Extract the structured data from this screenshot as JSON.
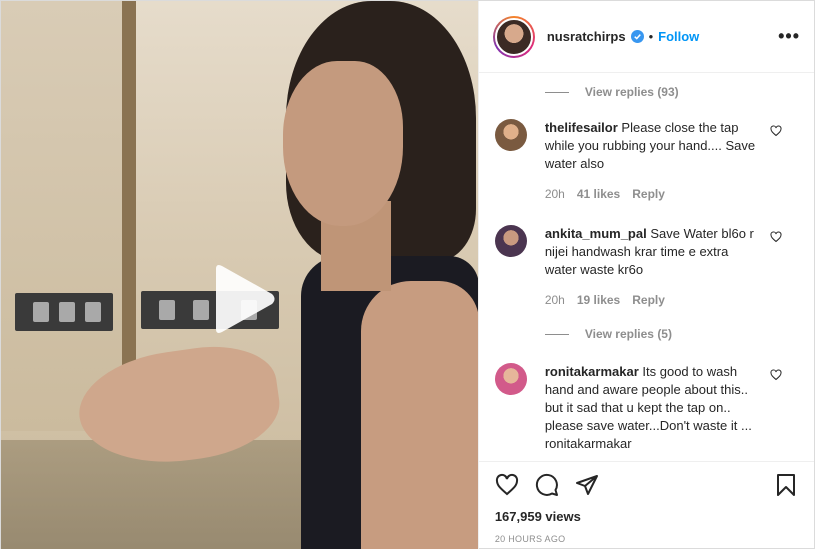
{
  "header": {
    "username": "nusratchirps",
    "separator": "•",
    "follow_label": "Follow",
    "more_label": "•••"
  },
  "comments": {
    "view_replies_top": "View replies (93)",
    "items": [
      {
        "user": "thelifesailor",
        "text": "Please close the tap while you rubbing your hand.... Save water also",
        "age": "20h",
        "likes": "41 likes",
        "reply_label": "Reply",
        "avatar_color": "#a07a5a"
      },
      {
        "user": "ankita_mum_pal",
        "text": "Save Water bl6o r nijei handwash krar time e extra water waste kr6o",
        "age": "20h",
        "likes": "19 likes",
        "reply_label": "Reply",
        "avatar_color": "#6b4a7a"
      },
      {
        "user": "ronitakarmakar",
        "text": "Its good to wash hand and aware people about this.. but it sad that u kept the tap on.. please save water...Don't waste it ... ronitakarmakar"
      }
    ],
    "view_replies_second": "View replies (5)",
    "third_avatar_color": "#d25a8a"
  },
  "footer": {
    "views": "167,959 views",
    "posted": "20 HOURS AGO"
  },
  "icons": {
    "play": "play-icon",
    "verified": "verified-badge-icon",
    "heart": "heart-icon",
    "comment": "comment-icon",
    "share": "share-icon",
    "bookmark": "bookmark-icon"
  },
  "colors": {
    "accent": "#0095f6",
    "muted": "#8e8e8e",
    "text": "#262626"
  }
}
